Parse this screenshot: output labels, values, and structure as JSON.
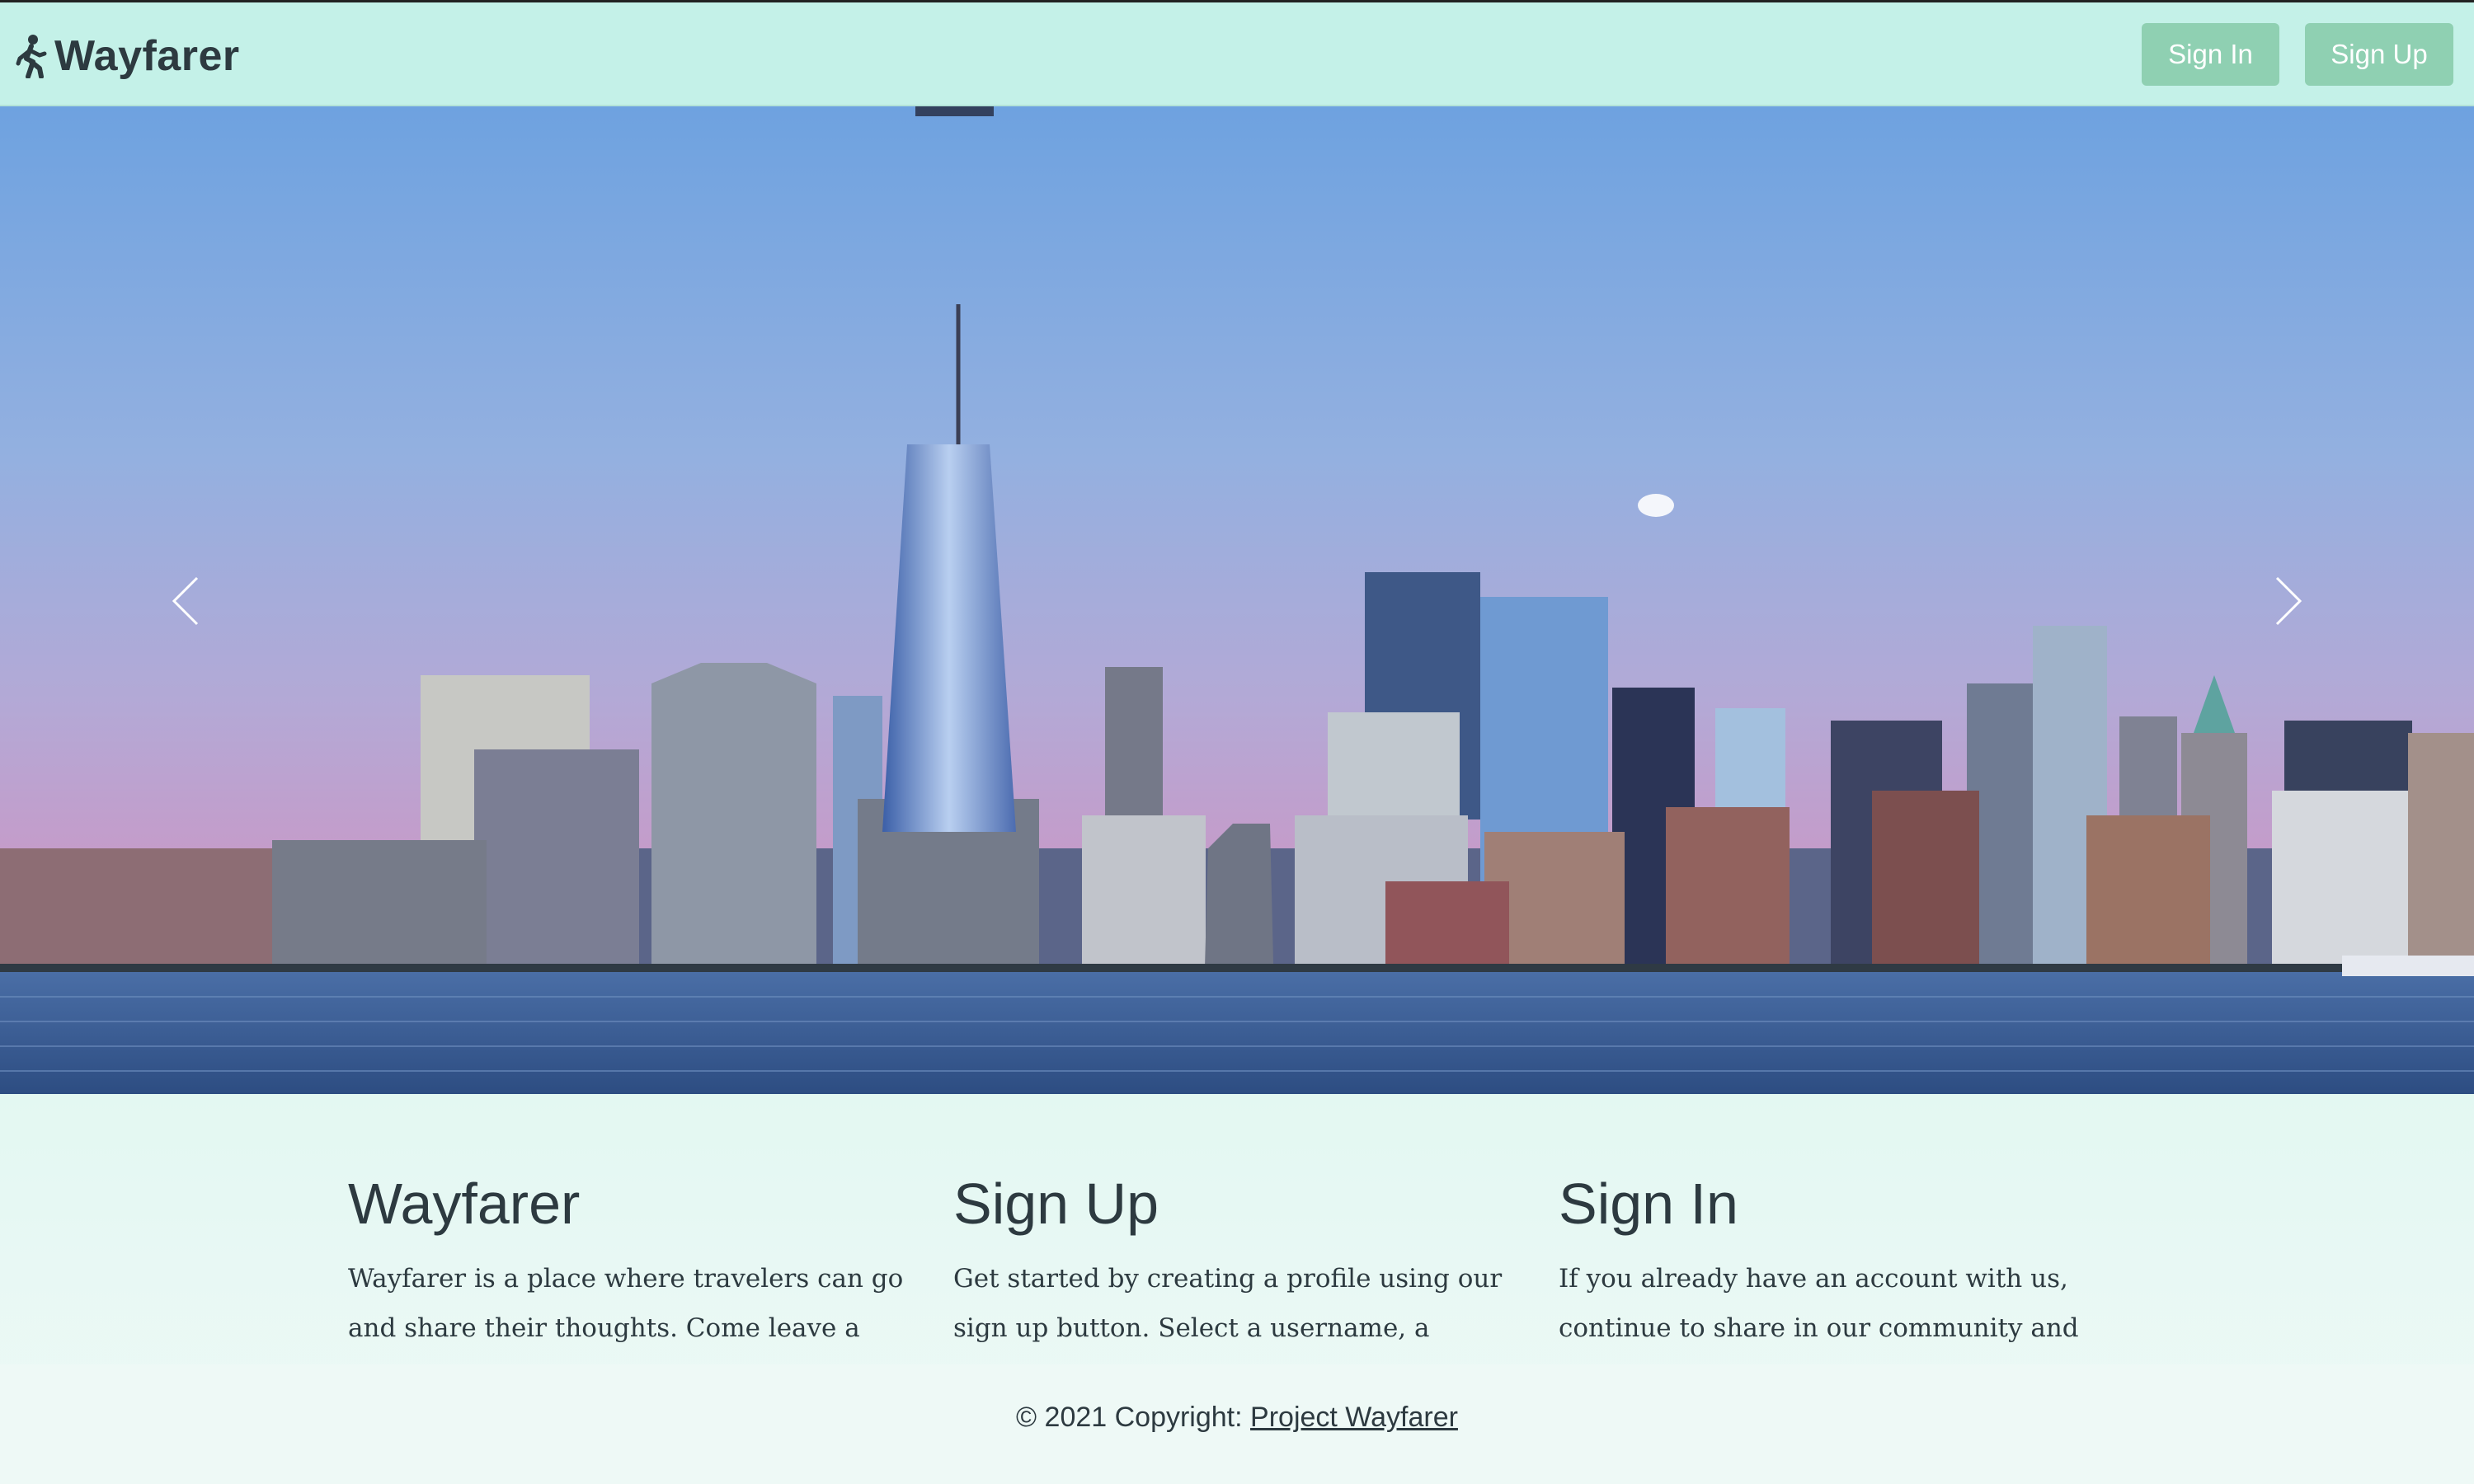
{
  "navbar": {
    "brand": "Wayfarer",
    "brand_icon": "walking-person-icon",
    "sign_in_label": "Sign In",
    "sign_up_label": "Sign Up",
    "accent_color": "#8fd0b2",
    "background_color": "#c4f1e8"
  },
  "carousel": {
    "prev_icon": "chevron-left-icon",
    "next_icon": "chevron-right-icon"
  },
  "sections": [
    {
      "title": "Wayfarer",
      "text": "Wayfarer is a place where travelers can go and share their thoughts. Come leave a recommendation or your favorite city..."
    },
    {
      "title": "Sign Up",
      "text": "Get started by creating a profile using our sign up button. Select a username, a secure password, choose your favorite city and also..."
    },
    {
      "title": "Sign In",
      "text": "If you already have an account with us, continue to share in our community and you should... Just use the sign in button at..."
    }
  ],
  "footer": {
    "copyright": "© 2021 Copyright:",
    "link_text": "Project Wayfarer"
  }
}
